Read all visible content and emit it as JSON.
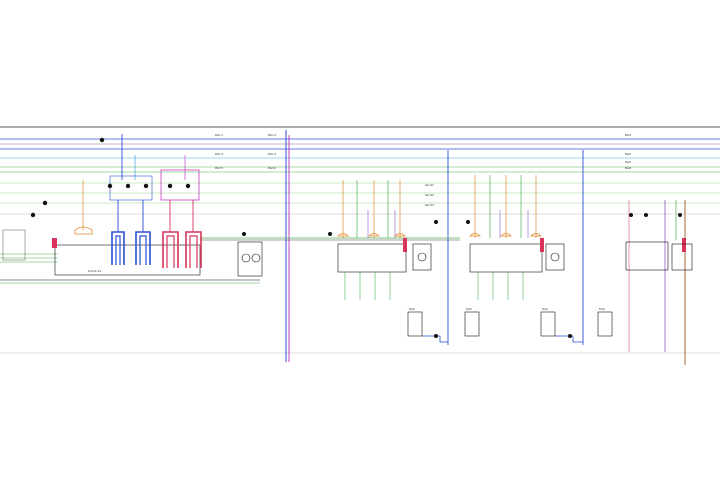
{
  "diagram": {
    "type": "hydraulic-schematic",
    "header_line_labels": [
      "Plan 1",
      "Plan 2",
      "Plan 3",
      "Plan 4",
      "Plan 5",
      "Plan 6"
    ],
    "right_line_labels": [
      "Nord",
      "Nord",
      "Nord",
      "Nord"
    ],
    "left_panel_caption": "Pump 01",
    "section_labels": [
      "Sec 01",
      "Sec 02",
      "Sec 03"
    ],
    "tank_label": "Tank",
    "colors": {
      "supply_blue": "#2a4fd6",
      "return_red": "#d8335a",
      "magenta": "#c040c0",
      "orange": "#e08a2a",
      "green": "#4caf50",
      "light_green": "#9ad48a",
      "cyan": "#39a9d9",
      "purple": "#8a5acb",
      "brown": "#9a5a2a",
      "pink": "#e07aa0",
      "black": "#111111",
      "grey": "#888888"
    }
  }
}
